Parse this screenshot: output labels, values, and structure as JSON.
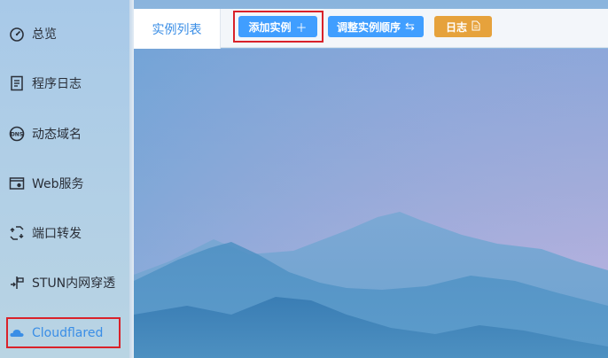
{
  "sidebar": {
    "items": [
      {
        "label": "总览",
        "icon": "dashboard-icon"
      },
      {
        "label": "程序日志",
        "icon": "log-file-icon"
      },
      {
        "label": "动态域名",
        "icon": "dns-icon"
      },
      {
        "label": "Web服务",
        "icon": "web-service-icon"
      },
      {
        "label": "端口转发",
        "icon": "port-forward-icon"
      },
      {
        "label": "STUN内网穿透",
        "icon": "stun-icon"
      },
      {
        "label": "Cloudflared",
        "icon": "cloud-icon",
        "active": true
      }
    ]
  },
  "topbar": {
    "tab_label": "实例列表",
    "add_label": "添加实例",
    "add_glyph": "＋",
    "order_label": "调整实例顺序",
    "order_glyph": "⇆",
    "log_label": "日志",
    "log_glyph": "🗎"
  },
  "colors": {
    "accent": "#409eff",
    "warning": "#e6a23c",
    "highlight": "#d9222a"
  }
}
